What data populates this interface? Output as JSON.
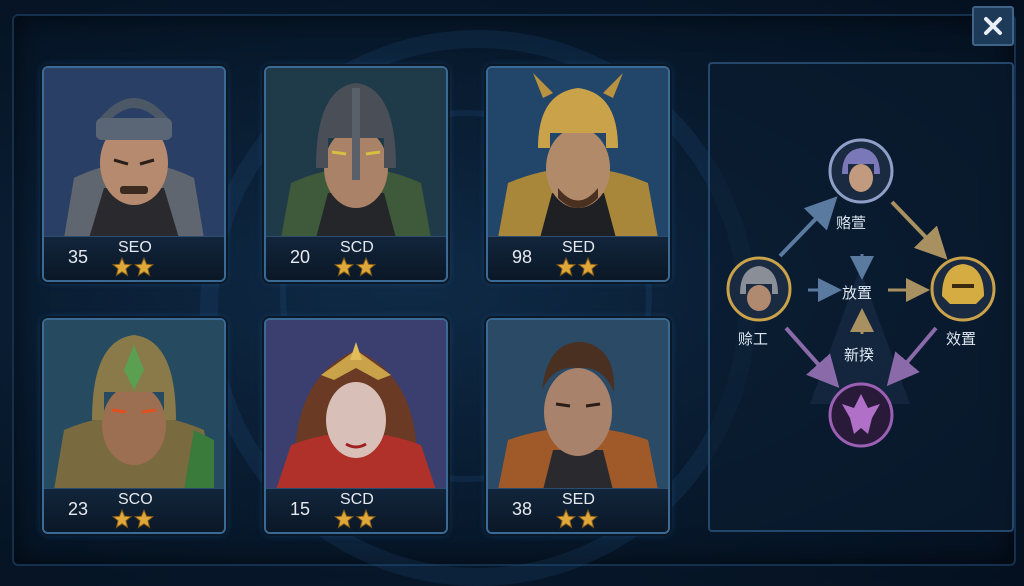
{
  "heroes": [
    {
      "level": "35",
      "class": "SEO",
      "stars": 2
    },
    {
      "level": "20",
      "class": "SCD",
      "stars": 2
    },
    {
      "level": "98",
      "class": "SED",
      "stars": 2
    },
    {
      "level": "23",
      "class": "SCO",
      "stars": 2
    },
    {
      "level": "15",
      "class": "SCD",
      "stars": 2
    },
    {
      "level": "38",
      "class": "SED",
      "stars": 2
    }
  ],
  "diagram": {
    "top_label": "赂萱",
    "left_label": "赊工",
    "right_label": "效置",
    "center_label": "放置",
    "lower_center_label": "新揆"
  },
  "close_icon": "close-icon",
  "colors": {
    "accent": "#3a6b96",
    "star": "#e0a83a",
    "gold": "#c9a24a",
    "purple": "#9b5fb3"
  }
}
